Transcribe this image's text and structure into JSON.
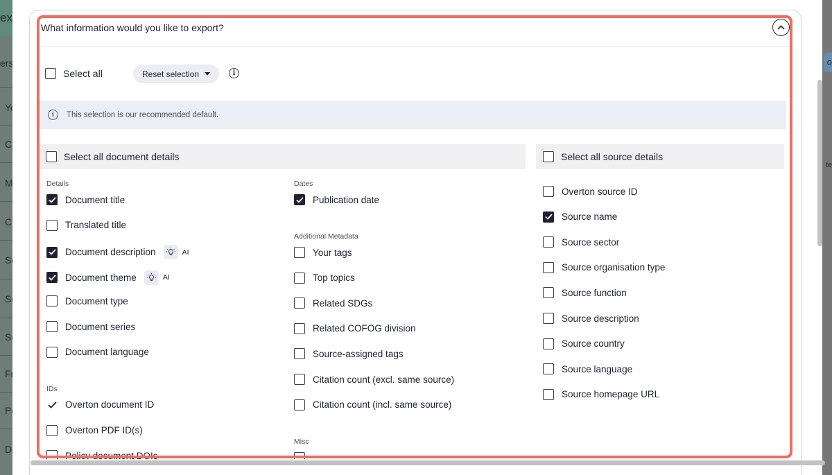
{
  "background": {
    "left_fragments": [
      "ex",
      "ers",
      "Yo",
      "Ci",
      "Me",
      "Ci",
      "So",
      "So",
      "So",
      "Fr",
      "Pe",
      "Do"
    ],
    "right_fragments": [
      "o",
      "te"
    ]
  },
  "dialog": {
    "question": "What information would you like to export?",
    "select_all_label": "Select all",
    "reset_label": "Reset selection",
    "notice": "This selection is our recommended default.",
    "select_all_document": "Select all document details",
    "select_all_source": "Select all source details",
    "ai_label": "AI"
  },
  "sections": {
    "details": {
      "label": "Details",
      "items": [
        {
          "label": "Document title",
          "checked": true
        },
        {
          "label": "Translated title",
          "checked": false
        },
        {
          "label": "Document description",
          "checked": true,
          "ai": true
        },
        {
          "label": "Document theme",
          "checked": true,
          "ai": true
        },
        {
          "label": "Document type",
          "checked": false
        },
        {
          "label": "Document series",
          "checked": false
        },
        {
          "label": "Document language",
          "checked": false
        }
      ]
    },
    "ids": {
      "label": "IDs",
      "items": [
        {
          "label": "Overton document ID",
          "checked": true,
          "locked": true
        },
        {
          "label": "Overton PDF ID(s)",
          "checked": false
        },
        {
          "label": "Policy document DOIs",
          "checked": false
        }
      ]
    },
    "dates": {
      "label": "Dates",
      "items": [
        {
          "label": "Publication date",
          "checked": true
        }
      ]
    },
    "additional": {
      "label": "Additional Metadata",
      "items": [
        {
          "label": "Your tags",
          "checked": false
        },
        {
          "label": "Top topics",
          "checked": false
        },
        {
          "label": "Related SDGs",
          "checked": false
        },
        {
          "label": "Related COFOG division",
          "checked": false
        },
        {
          "label": "Source-assigned tags",
          "checked": false
        },
        {
          "label": "Citation count (excl. same source)",
          "checked": false
        },
        {
          "label": "Citation count (incl. same source)",
          "checked": false
        }
      ]
    },
    "misc": {
      "label": "Misc"
    },
    "source": {
      "items": [
        {
          "label": "Overton source ID",
          "checked": false
        },
        {
          "label": "Source name",
          "checked": true
        },
        {
          "label": "Source sector",
          "checked": false
        },
        {
          "label": "Source organisation type",
          "checked": false
        },
        {
          "label": "Source function",
          "checked": false
        },
        {
          "label": "Source description",
          "checked": false
        },
        {
          "label": "Source country",
          "checked": false
        },
        {
          "label": "Source language",
          "checked": false
        },
        {
          "label": "Source homepage URL",
          "checked": false
        }
      ]
    }
  },
  "colors": {
    "highlight": "#ec6f61",
    "checkbox_checked": "#1f2133",
    "notice_bg": "#eceef6"
  }
}
